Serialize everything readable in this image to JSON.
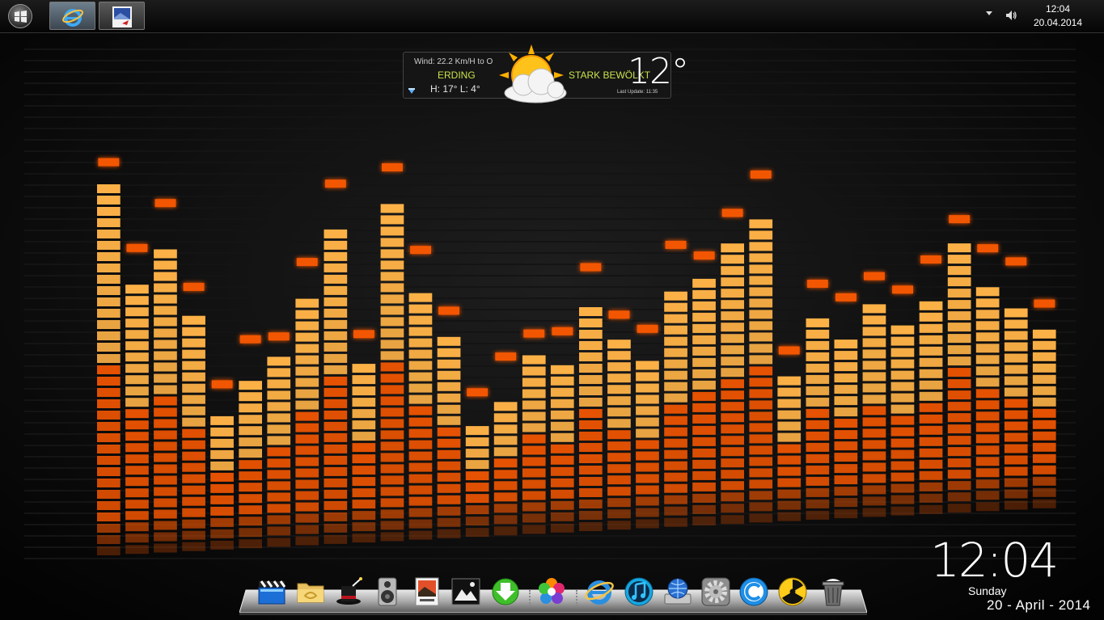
{
  "taskbar": {
    "start": {
      "icon": "windows-logo-icon"
    },
    "pinned": [
      {
        "name": "internet-explorer",
        "icon": "internet-explorer-icon"
      },
      {
        "name": "image-app",
        "icon": "image-app-icon"
      }
    ],
    "tray": {
      "time": "12:04",
      "date": "20.04.2014"
    }
  },
  "weather": {
    "wind": "Wind: 22.2 Km/H to O",
    "city": "ERDING",
    "high_low": "H: 17° L: 4°",
    "condition": "STARK BEWÖLKT",
    "temperature": "12°",
    "last_update": "Last Update: 11:35",
    "icon": "partly-cloudy-icon"
  },
  "desktop_clock": {
    "time": "12:04",
    "day": "Sunday",
    "date": "20 - April - 2014"
  },
  "wallpaper": {
    "accent_top": "#ffb347",
    "accent_bottom": "#ff5a00",
    "bar_levels": [
      0.86,
      0.64,
      0.72,
      0.57,
      0.32,
      0.4,
      0.45,
      0.6,
      0.76,
      0.45,
      0.82,
      0.6,
      0.5,
      0.28,
      0.34,
      0.44,
      0.42,
      0.55,
      0.48,
      0.42,
      0.6,
      0.62,
      0.7,
      0.77,
      0.38,
      0.52,
      0.46,
      0.56,
      0.5,
      0.55,
      0.7,
      0.6,
      0.54,
      0.48
    ]
  },
  "dock": {
    "items": [
      {
        "name": "video-clapper",
        "icon": "clapper-icon"
      },
      {
        "name": "folder",
        "icon": "folder-icon"
      },
      {
        "name": "magic-hat",
        "icon": "magic-hat-icon"
      },
      {
        "name": "speaker",
        "icon": "speaker-icon"
      },
      {
        "name": "photo-viewer",
        "icon": "photo-icon"
      },
      {
        "name": "picture-frame",
        "icon": "picture-frame-icon"
      },
      {
        "name": "downloader",
        "icon": "download-icon"
      },
      {
        "name": "photos-flower",
        "icon": "flower-icon"
      },
      {
        "name": "internet-explorer",
        "icon": "internet-explorer-icon"
      },
      {
        "name": "itunes",
        "icon": "music-note-icon"
      },
      {
        "name": "network",
        "icon": "network-globe-icon"
      },
      {
        "name": "settings",
        "icon": "gear-icon"
      },
      {
        "name": "ccleaner",
        "icon": "ccleaner-icon"
      },
      {
        "name": "burn",
        "icon": "radiation-icon"
      },
      {
        "name": "recycle-bin",
        "icon": "trash-icon"
      }
    ]
  }
}
